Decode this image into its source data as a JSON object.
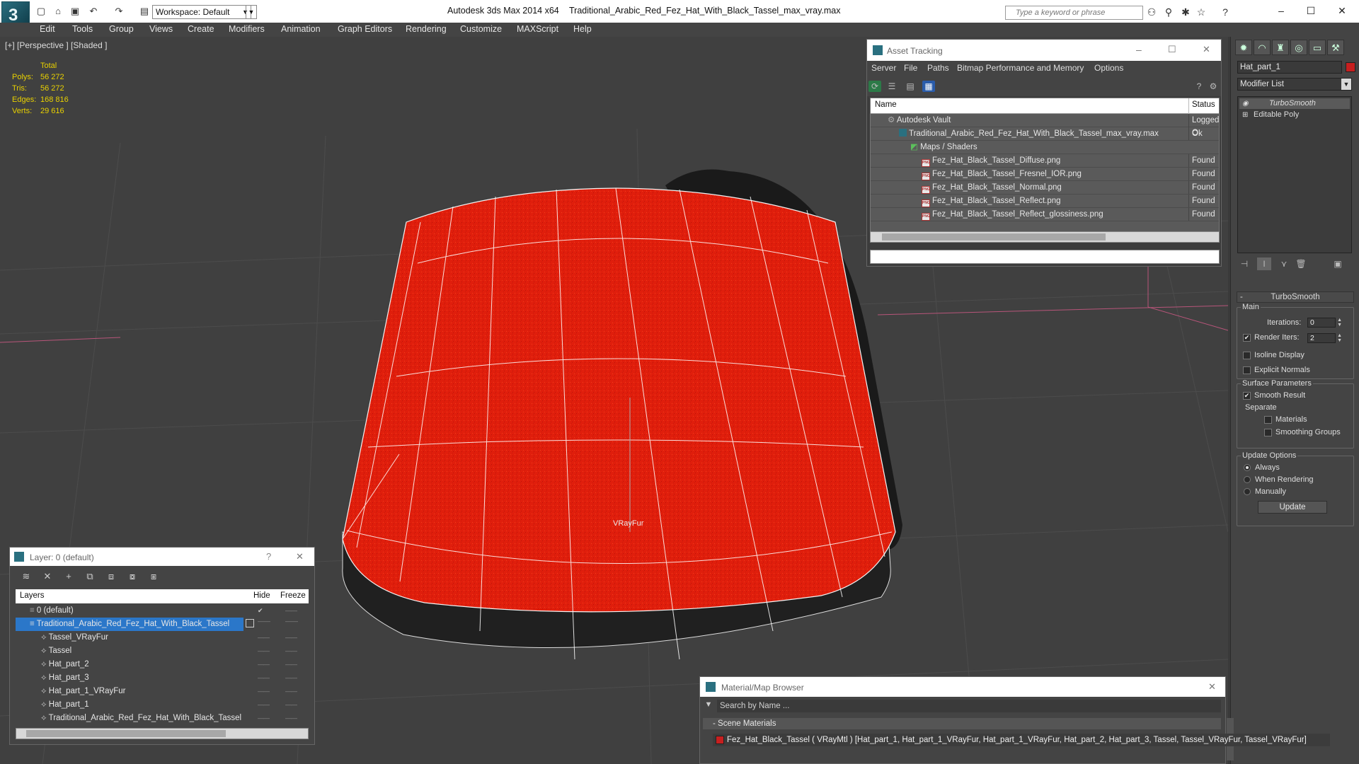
{
  "titlebar": {
    "workspace": "Workspace: Default",
    "app_title": "Autodesk 3ds Max  2014 x64",
    "file_title": "Traditional_Arabic_Red_Fez_Hat_With_Black_Tassel_max_vray.max",
    "search_placeholder": "Type a keyword or phrase"
  },
  "menu": [
    "Edit",
    "Tools",
    "Group",
    "Views",
    "Create",
    "Modifiers",
    "Animation",
    "Graph Editors",
    "Rendering",
    "Customize",
    "MAXScript",
    "Help"
  ],
  "viewport": {
    "label": "[+] [Perspective ] [Shaded ]",
    "stats_header": "Total",
    "stats": [
      {
        "label": "Polys:",
        "value": "56 272"
      },
      {
        "label": "Tris:",
        "value": "56 272"
      },
      {
        "label": "Edges:",
        "value": "168 816"
      },
      {
        "label": "Verts:",
        "value": "29 616"
      }
    ],
    "object_label": "VRayFur"
  },
  "asset_tracking": {
    "title": "Asset Tracking",
    "menu": [
      "Server",
      "File",
      "Paths",
      "Bitmap Performance and Memory",
      "Options"
    ],
    "col_name": "Name",
    "col_status": "Status",
    "rows": [
      {
        "name": "Autodesk Vault",
        "status": "Logged O",
        "indent": 1,
        "icon": "vault-icon"
      },
      {
        "name": "Traditional_Arabic_Red_Fez_Hat_With_Black_Tassel_max_vray.max",
        "status": "Ok",
        "indent": 2,
        "icon": "max-file-icon"
      },
      {
        "name": "Maps / Shaders",
        "status": "",
        "indent": 3,
        "icon": "maps-icon"
      },
      {
        "name": "Fez_Hat_Black_Tassel_Diffuse.png",
        "status": "Found",
        "indent": 4,
        "icon": "png-icon"
      },
      {
        "name": "Fez_Hat_Black_Tassel_Fresnel_IOR.png",
        "status": "Found",
        "indent": 4,
        "icon": "png-icon"
      },
      {
        "name": "Fez_Hat_Black_Tassel_Normal.png",
        "status": "Found",
        "indent": 4,
        "icon": "png-icon"
      },
      {
        "name": "Fez_Hat_Black_Tassel_Reflect.png",
        "status": "Found",
        "indent": 4,
        "icon": "png-icon"
      },
      {
        "name": "Fez_Hat_Black_Tassel_Reflect_glossiness.png",
        "status": "Found",
        "indent": 4,
        "icon": "png-icon"
      }
    ]
  },
  "command_panel": {
    "object_name": "Hat_part_1",
    "object_color": "#c71f1f",
    "modifier_list": "Modifier List",
    "stack": [
      "TurboSmooth",
      "Editable Poly"
    ],
    "turbosmooth": {
      "title": "TurboSmooth",
      "main_label": "Main",
      "iterations_label": "Iterations:",
      "iterations": "0",
      "render_iters_label": "Render Iters:",
      "render_iters": "2",
      "isoline": "Isoline Display",
      "explicit_normals": "Explicit Normals",
      "surface_params": "Surface Parameters",
      "smooth_result": "Smooth Result",
      "separate": "Separate",
      "materials": "Materials",
      "smoothing_groups": "Smoothing Groups",
      "update_options": "Update Options",
      "always": "Always",
      "when_rendering": "When Rendering",
      "manually": "Manually",
      "update_button": "Update"
    }
  },
  "layer_explorer": {
    "title": "Layer: 0 (default)",
    "col_layers": "Layers",
    "col_hide": "Hide",
    "col_freeze": "Freeze",
    "rows": [
      {
        "name": "0 (default)",
        "indent": 1,
        "selected": false
      },
      {
        "name": "Traditional_Arabic_Red_Fez_Hat_With_Black_Tassel",
        "indent": 1,
        "selected": true
      },
      {
        "name": "Tassel_VRayFur",
        "indent": 2,
        "selected": false
      },
      {
        "name": "Tassel",
        "indent": 2,
        "selected": false
      },
      {
        "name": "Hat_part_2",
        "indent": 2,
        "selected": false
      },
      {
        "name": "Hat_part_3",
        "indent": 2,
        "selected": false
      },
      {
        "name": "Hat_part_1_VRayFur",
        "indent": 2,
        "selected": false
      },
      {
        "name": "Hat_part_1",
        "indent": 2,
        "selected": false
      },
      {
        "name": "Traditional_Arabic_Red_Fez_Hat_With_Black_Tassel",
        "indent": 2,
        "selected": false
      }
    ]
  },
  "material_browser": {
    "title": "Material/Map Browser",
    "search_placeholder": "Search by Name ...",
    "section": "- Scene Materials",
    "item": "Fez_Hat_Black_Tassel  ( VRayMtl ) [Hat_part_1, Hat_part_1_VRayFur, Hat_part_1_VRayFur, Hat_part_2, Hat_part_3, Tassel, Tassel_VRayFur, Tassel_VRayFur]"
  }
}
